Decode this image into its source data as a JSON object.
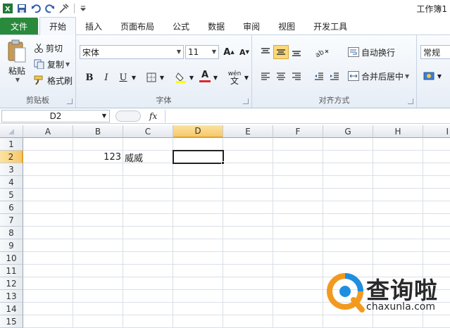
{
  "window": {
    "title": "工作簿1"
  },
  "tabs": [
    "文件",
    "开始",
    "插入",
    "页面布局",
    "公式",
    "数据",
    "审阅",
    "视图",
    "开发工具"
  ],
  "clipboard": {
    "paste": "粘贴",
    "cut": "剪切",
    "copy": "复制",
    "format_painter": "格式刷",
    "label": "剪贴板"
  },
  "font": {
    "name": "宋体",
    "size": "11",
    "label": "字体",
    "bold": "B",
    "italic": "I",
    "underline": "U",
    "font_color_glyph": "A",
    "phonetic": "wén"
  },
  "alignment": {
    "wrap": "自动换行",
    "merge": "合并后居中",
    "label": "对齐方式"
  },
  "number": {
    "format": "常规"
  },
  "formula_bar": {
    "name_box": "D2",
    "fx": "fx",
    "content": ""
  },
  "grid": {
    "columns": [
      "A",
      "B",
      "C",
      "D",
      "E",
      "F",
      "G",
      "H",
      "I"
    ],
    "rows": [
      "1",
      "2",
      "3",
      "4",
      "5",
      "6",
      "7",
      "8",
      "9",
      "10",
      "11",
      "12",
      "13",
      "14",
      "15"
    ],
    "selected_column": "D",
    "selected_row": "2",
    "cells": {
      "B2": "123",
      "C2": "威威"
    }
  },
  "watermark": {
    "brand": "查询啦",
    "url": "chaxunla.com"
  },
  "colors": {
    "file_tab": "#2a8a3c",
    "selection": "#f6c86a",
    "accent_orange": "#f29a1f",
    "accent_blue": "#1e8fe0"
  }
}
